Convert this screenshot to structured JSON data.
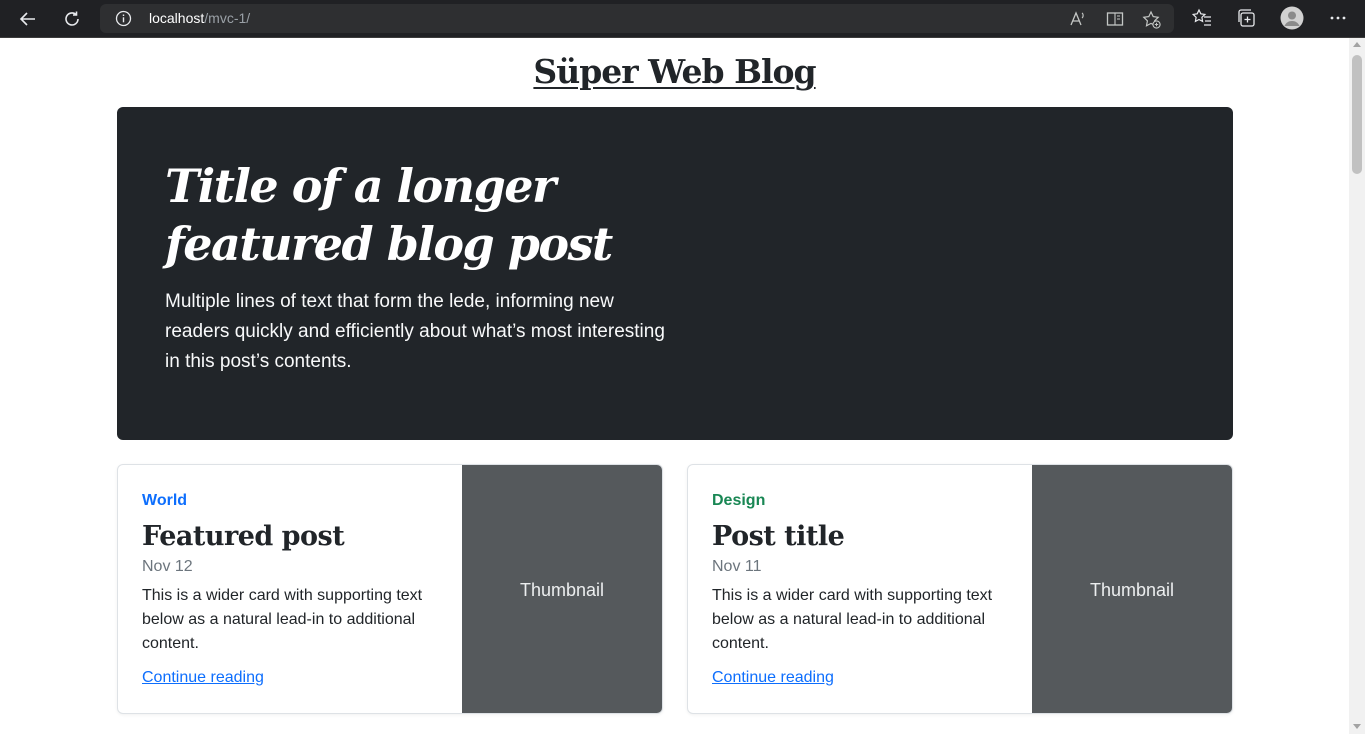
{
  "browser": {
    "url_host": "localhost",
    "url_path": "/mvc-1/"
  },
  "icons": {
    "back": "back-arrow-icon",
    "refresh": "refresh-icon",
    "info": "info-icon",
    "read_aloud": "read-aloud-icon",
    "immersive_reader": "immersive-reader-icon",
    "add_favorite": "add-favorite-icon",
    "favorites": "favorites-icon",
    "collections": "collections-icon",
    "profile": "profile-icon",
    "more": "more-icon"
  },
  "site": {
    "title": "Süper Web Blog"
  },
  "hero": {
    "title": "Title of a longer featured blog post",
    "lede": "Multiple lines of text that form the lede, informing new readers quickly and efficiently about what’s most interesting in this post’s contents."
  },
  "cards": [
    {
      "category": "World",
      "category_color": "#0d6efd",
      "title": "Featured post",
      "date": "Nov 12",
      "text": "This is a wider card with supporting text below as a natural lead-in to additional content.",
      "link": "Continue reading",
      "thumbnail": "Thumbnail"
    },
    {
      "category": "Design",
      "category_color": "#198754",
      "title": "Post title",
      "date": "Nov 11",
      "text": "This is a wider card with supporting text below as a natural lead-in to additional content.",
      "link": "Continue reading",
      "thumbnail": "Thumbnail"
    }
  ]
}
